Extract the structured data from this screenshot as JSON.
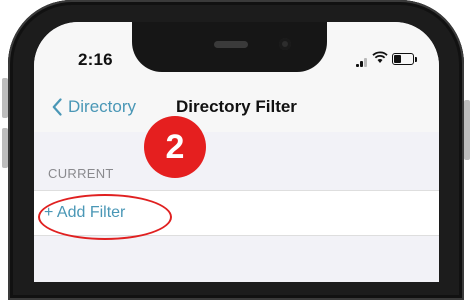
{
  "status_bar": {
    "time": "2:16",
    "signal_icon": "signal-bars",
    "wifi_icon": "wifi",
    "battery_icon": "battery"
  },
  "nav": {
    "back_label": "Directory",
    "back_icon": "chevron-left",
    "title": "Directory Filter"
  },
  "section": {
    "label": "CURRENT"
  },
  "list": {
    "add_filter_label": "+ Add Filter"
  },
  "annotation": {
    "step_number": "2"
  },
  "colors": {
    "accent": "#4a97b6",
    "annotation": "#e51f1f",
    "grouped_background": "#f2f2f7"
  }
}
